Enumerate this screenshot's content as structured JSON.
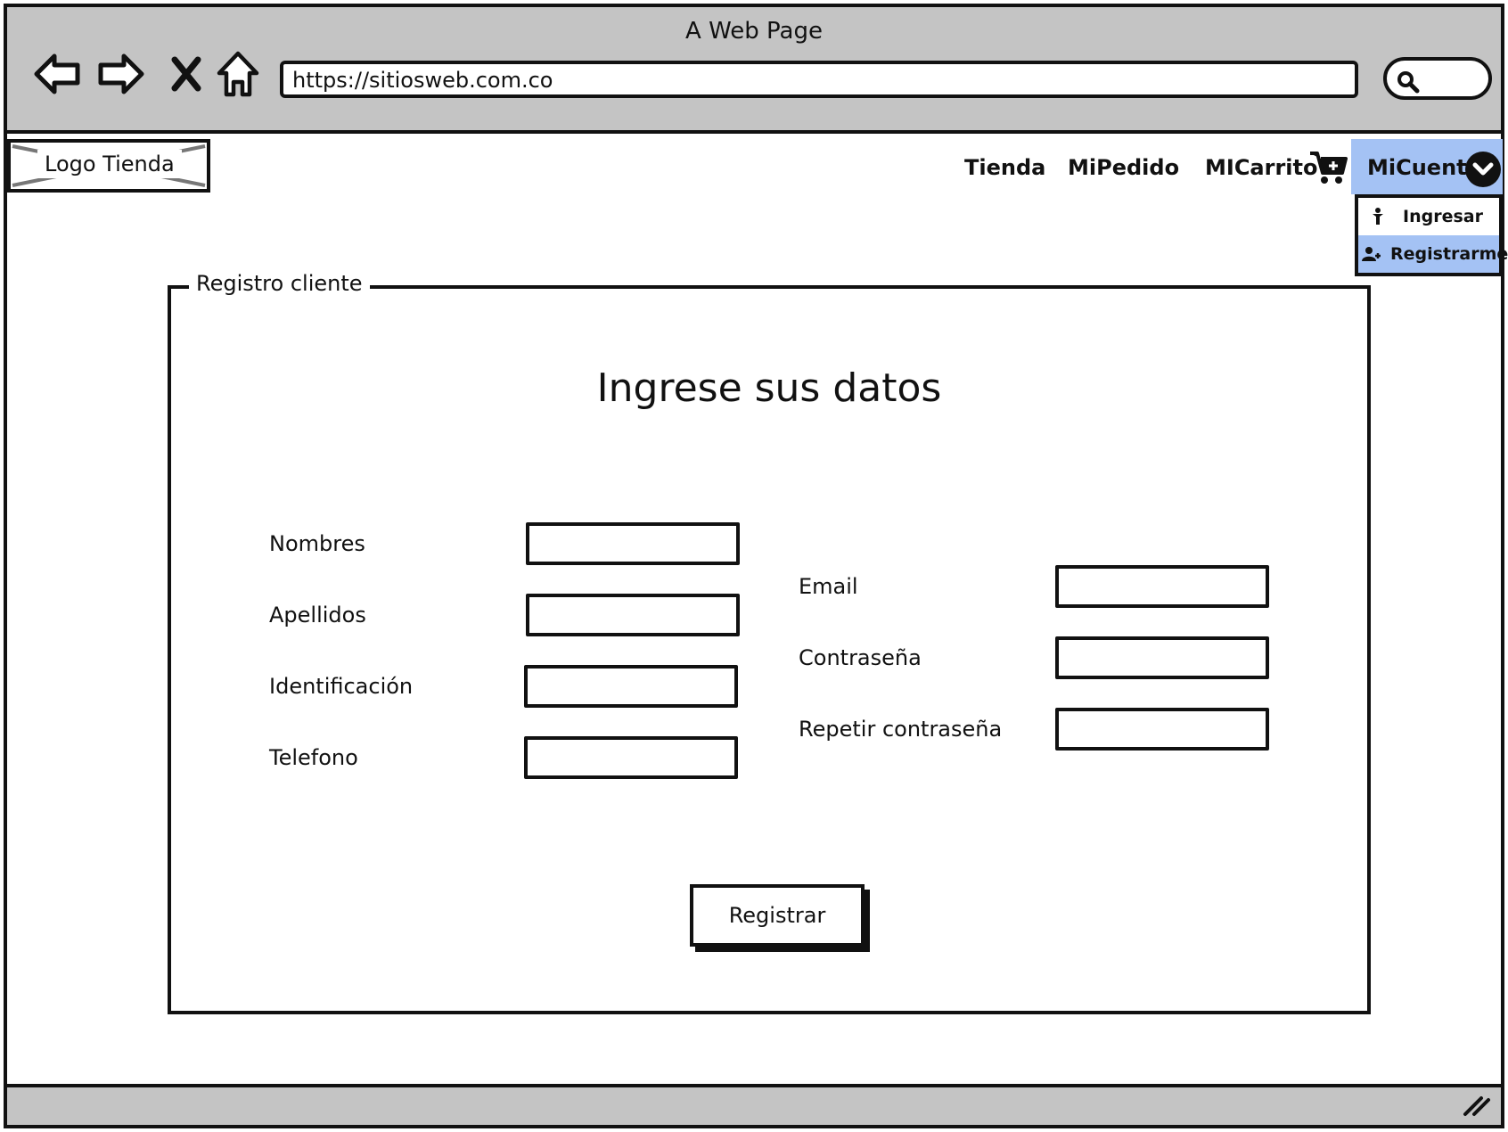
{
  "window": {
    "title": "A Web Page"
  },
  "browser": {
    "url": "https://sitiosweb.com.co",
    "icons": [
      "back-arrow-icon",
      "forward-arrow-icon",
      "close-icon",
      "home-icon",
      "search-icon"
    ]
  },
  "header": {
    "logo": "Logo Tienda",
    "nav": {
      "tienda": "Tienda",
      "mipedido": "MiPedido",
      "micarrito": "MICarrito",
      "micuenta": "MiCuenta"
    },
    "account_menu": {
      "ingresar": "Ingresar",
      "registrarme": "Registrarme"
    }
  },
  "form": {
    "legend": "Registro cliente",
    "title": "Ingrese sus datos",
    "fields": {
      "nombres": {
        "label": "Nombres",
        "value": ""
      },
      "apellidos": {
        "label": "Apellidos",
        "value": ""
      },
      "identificacion": {
        "label": "Identificación",
        "value": ""
      },
      "telefono": {
        "label": "Telefono",
        "value": ""
      },
      "email": {
        "label": "Email",
        "value": ""
      },
      "contrasena": {
        "label": "Contraseña",
        "value": ""
      },
      "repetir": {
        "label": "Repetir contraseña",
        "value": ""
      }
    },
    "submit_label": "Registrar"
  },
  "colors": {
    "chrome": "#c4c4c4",
    "highlight": "#a4c2f4",
    "ink": "#111111"
  }
}
